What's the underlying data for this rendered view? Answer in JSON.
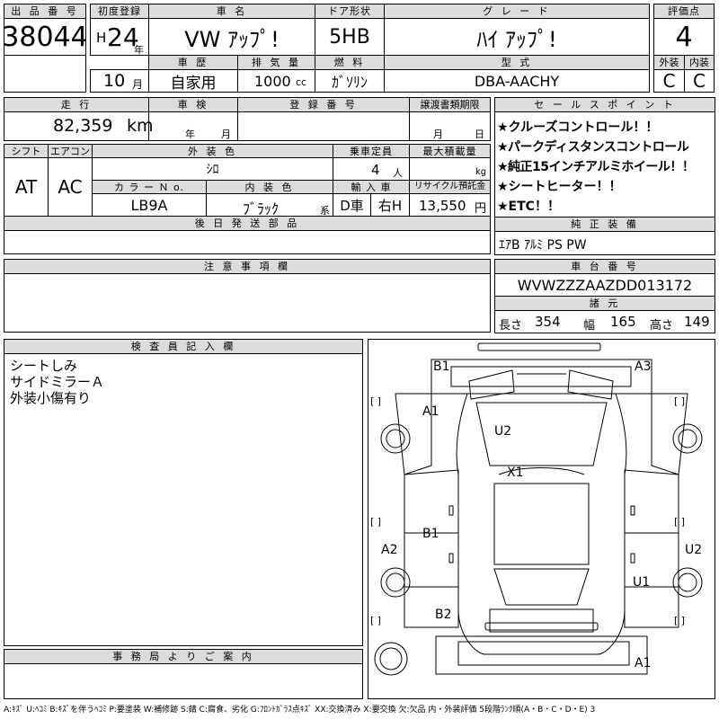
{
  "header": {
    "lot_no_label": "出 品 番 号",
    "lot_no": "38044",
    "first_reg_label": "初度登録",
    "era": "H",
    "year": "24",
    "year_unit": "年",
    "month": "10",
    "month_unit": "月",
    "car_name_label": "車 名",
    "car_name": "VW ｱｯﾌﾟ!",
    "door_label": "ドア形状",
    "door": "5HB",
    "grade_label": "グ レ ー ド",
    "grade": "ﾊｲ ｱｯﾌﾟ!",
    "score_label": "評価点",
    "score": "4",
    "history_label": "車 歴",
    "history": "自家用",
    "displacement_label": "排 気 量",
    "displacement": "1000",
    "displacement_unit": "cc",
    "fuel_label": "燃 料",
    "fuel": "ｶﾞｿﾘﾝ",
    "model_label": "型 式",
    "model": "DBA-AACHY",
    "exterior_label": "外装",
    "exterior_grade": "C",
    "interior_label": "内装",
    "interior_grade": "C"
  },
  "row2": {
    "mileage_label": "走 行",
    "mileage": "82,359",
    "mileage_unit": "km",
    "inspection_label": "車 検",
    "year_unit": "年",
    "month_unit": "月",
    "plate_label": "登 録 番 号",
    "transfer_label": "譲渡書類期限",
    "day_unit": "日"
  },
  "sales_points": {
    "label": "セ ー ル ス ポ イ ン ト",
    "items": [
      "★クルーズコントロール！！",
      "★パークディスタンスコントロール",
      "★純正15インチアルミホイール！！",
      "★シートヒーター！！",
      "★ETC！！"
    ]
  },
  "row3": {
    "shift_label": "シフト",
    "shift": "AT",
    "ac_label": "エアコン",
    "ac": "AC",
    "color_label": "外 装 色",
    "color": "ｼﾛ",
    "capacity_label": "乗車定員",
    "capacity": "4",
    "capacity_unit": "人",
    "load_label": "最大積載量",
    "load_unit": "kg",
    "color_no_label": "カ ラ ー Ｎ o.",
    "color_no": "LB9A",
    "interior_color_label": "内 装 色",
    "interior_color": "ﾌﾞﾗｯｸ",
    "interior_color_suffix": "系",
    "import_label": "輸 入 車",
    "import_d": "D車",
    "import_h": "右H",
    "recycle_label": "リサイクル預託金",
    "recycle": "13,550",
    "recycle_unit": "円"
  },
  "later_parts_label": "後 日 発 送 部 品",
  "genuine_equipment": {
    "label": "純 正 装 備",
    "value": "ｴｱB ｱﾙﾐ PS PW"
  },
  "notes_label": "注 意 事 項 欄",
  "chassis": {
    "label": "車 台 番 号",
    "value": "WVWZZZAAZDD013172",
    "dims_label": "諸 元",
    "length_label": "長さ",
    "length": "354",
    "width_label": "幅",
    "width": "165",
    "height_label": "高さ",
    "height": "149"
  },
  "inspector": {
    "label": "検 査 員 記 入 欄",
    "lines": [
      "シートしみ",
      "サイドミラーＡ",
      "外装小傷有り"
    ]
  },
  "office_label": "事 務 局 よ り ご 案 内",
  "diagram": {
    "marks": [
      "B1",
      "A3",
      "A1",
      "U2",
      "X1",
      "B1",
      "A2",
      "U2",
      "U1",
      "B2",
      "A1"
    ],
    "bracket": "[      ]"
  },
  "legend": "A:ｷｽﾞ U:ﾍｺﾐ B:ｷｽﾞを伴うﾍｺﾐ P:要塗装 W:補修跡 S:錆 C:腐食、劣化 G:ﾌﾛﾝﾄｶﾞﾗｽ点ｷｽﾞ XX:交換済み X:要交換 欠:欠品 内・外装評価 5段階ﾗﾝｸ順(A・B・C・D・E) 3"
}
